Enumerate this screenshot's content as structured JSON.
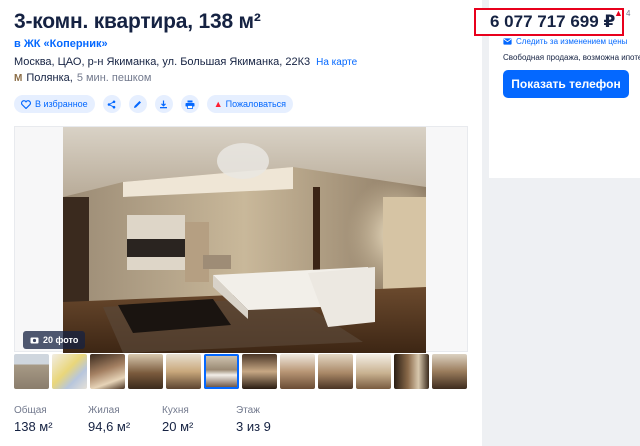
{
  "listing": {
    "title": "3-комн. квартира, 138 м²",
    "complex_link": "в ЖК «Коперник»",
    "address": "Москва, ЦАО, р-н Якиманка, ул. Большая Якиманка, 22К3",
    "map_link": "На карте",
    "metro_icon": "М",
    "metro_station": "Полянка,",
    "metro_time": "5 мин. пешком"
  },
  "actions": {
    "favorite_label": "В избранное",
    "report_label": "Пожаловаться",
    "icons": [
      "heart-icon",
      "share-icon",
      "edit-icon",
      "download-icon",
      "print-icon",
      "warning-icon"
    ]
  },
  "gallery": {
    "photo_count": "20 фото",
    "thumb_count": 12,
    "active_thumb": 5
  },
  "specs": [
    {
      "label": "Общая",
      "value": "138 м²"
    },
    {
      "label": "Жилая",
      "value": "94,6 м²"
    },
    {
      "label": "Кухня",
      "value": "20 м²"
    },
    {
      "label": "Этаж",
      "value": "3 из 9"
    }
  ],
  "price_card": {
    "price": "6 077 717 699 ₽",
    "price_hint": "4",
    "follow_label": "Следить за изменением цены",
    "sale_info": "Свободная продажа, возможна ипоте",
    "phone_button": "Показать телефон"
  },
  "colors": {
    "accent": "#0468ff",
    "text": "#152242",
    "highlight_border": "#e8001c"
  }
}
